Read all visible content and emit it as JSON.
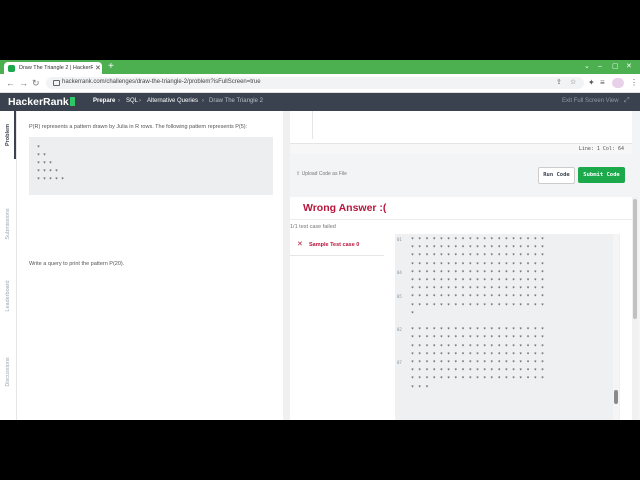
{
  "browser": {
    "tab_title": "Draw The Triangle 2 | HackerRank",
    "tab_close": "✕",
    "new_tab": "+",
    "window_controls": [
      "⌄",
      "–",
      "▢",
      "✕"
    ],
    "url": "hackerrank.com/challenges/draw-the-triangle-2/problem?isFullScreen=true",
    "nav_icons": [
      "back-arrow-icon",
      "forward-arrow-icon",
      "reload-icon"
    ],
    "nav_glyphs": [
      "←",
      "→",
      "↻"
    ],
    "omni_glyphs": [
      "⇪",
      "☆"
    ],
    "toolbar_glyphs": [
      "✦",
      "≡",
      "▣",
      "⋮"
    ]
  },
  "header": {
    "logo": "HackerRank",
    "breadcrumbs": [
      "Prepare",
      "SQL",
      "Alternative Queries",
      "Draw The Triangle 2"
    ],
    "separator": "›",
    "exit_label": "Exit Full Screen View",
    "exit_glyph": "⤢"
  },
  "side_tabs": [
    "Problem",
    "Submissions",
    "Leaderboard",
    "Discussions"
  ],
  "problem": {
    "intro": "P(R) represents a pattern drawn by Julia in R rows. The following pattern represents P(5):",
    "pattern": [
      "*",
      "* *",
      "* * *",
      "* * * *",
      "* * * * *"
    ],
    "task": "Write a query to print the pattern P(20)."
  },
  "editor": {
    "cursor_position": "Line: 1 Col: 64",
    "upload_label": "Upload Code as File",
    "upload_glyph": "⇧",
    "run_label": "Run Code",
    "submit_label": "Submit Code"
  },
  "result": {
    "heading": "Wrong Answer :(",
    "summary": "1/1 test case failed",
    "case_label": "Sample Test case 0",
    "case_glyph": "✕",
    "output_rows": [
      {
        "line": "01",
        "stars": 19
      },
      {
        "line": "",
        "stars": 19
      },
      {
        "line": "",
        "stars": 19
      },
      {
        "line": "",
        "stars": 19
      },
      {
        "line": "04",
        "stars": 19
      },
      {
        "line": "",
        "stars": 19
      },
      {
        "line": "",
        "stars": 19
      },
      {
        "line": "05",
        "stars": 19
      },
      {
        "line": "",
        "stars": 19
      },
      {
        "line": "",
        "stars": 1
      },
      {
        "line": "",
        "stars": 0
      },
      {
        "line": "02",
        "stars": 19
      },
      {
        "line": "",
        "stars": 19
      },
      {
        "line": "",
        "stars": 19
      },
      {
        "line": "",
        "stars": 19
      },
      {
        "line": "07",
        "stars": 19
      },
      {
        "line": "",
        "stars": 19
      },
      {
        "line": "",
        "stars": 19
      },
      {
        "line": "",
        "stars": 3
      }
    ]
  }
}
